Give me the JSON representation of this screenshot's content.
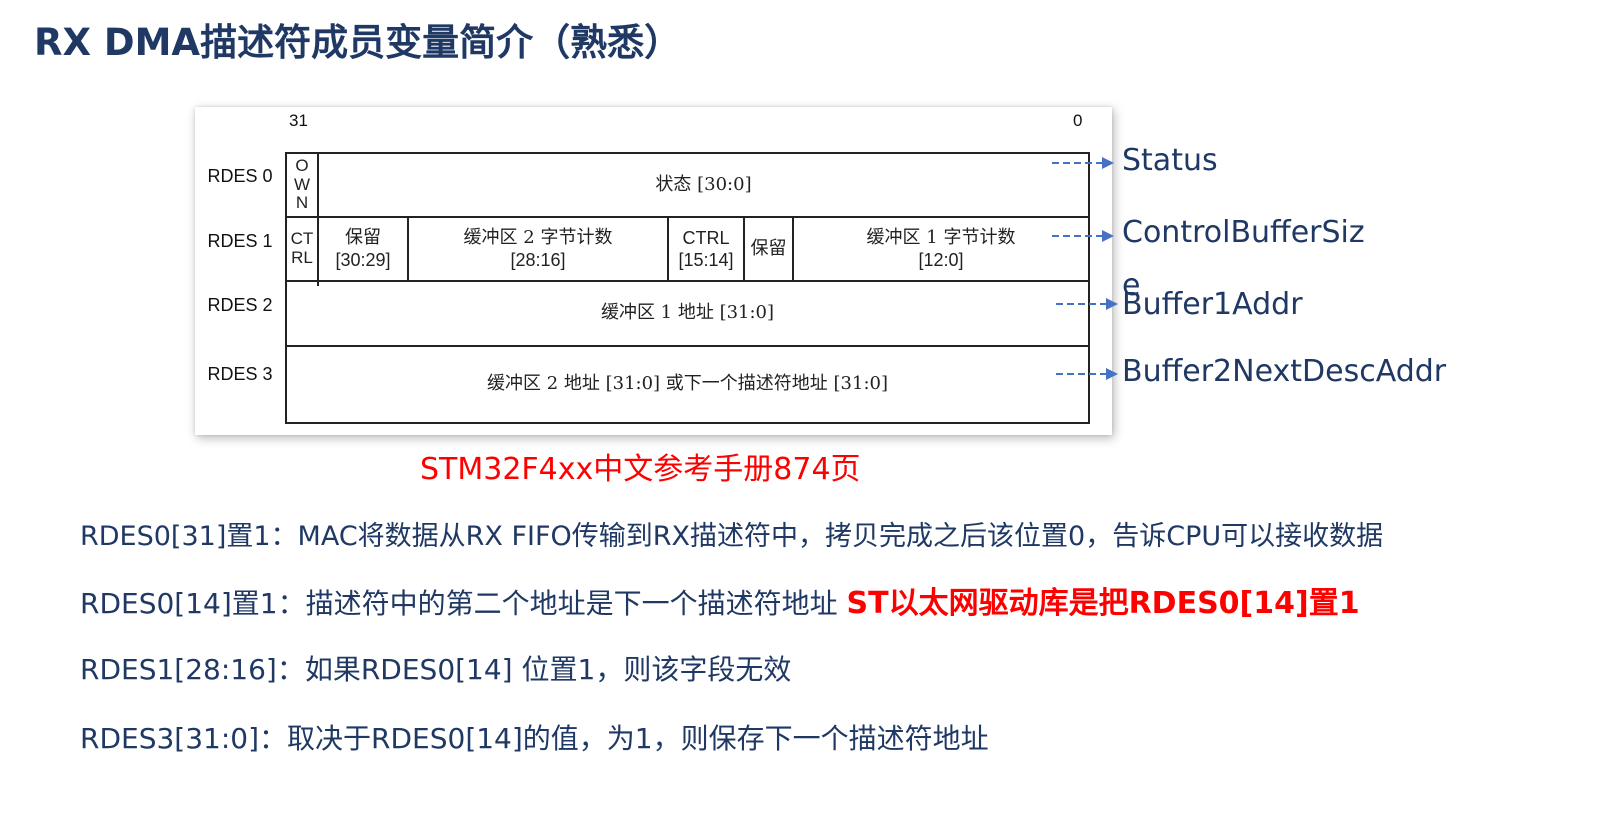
{
  "title": "RX DMA描述符成员变量简介（熟悉）",
  "figure": {
    "bit_high": "31",
    "bit_low": "0",
    "rows": [
      "RDES 0",
      "RDES 1",
      "RDES 2",
      "RDES 3"
    ],
    "own": [
      "O",
      "W",
      "N"
    ],
    "status": "状态 [30:0]",
    "ctrl_left": [
      "CT",
      "RL"
    ],
    "reserved1": [
      "保留",
      "[30:29]"
    ],
    "buf2_count": [
      "缓冲区 2 字节计数",
      "[28:16]"
    ],
    "ctrl_mid": [
      "CTRL",
      "[15:14]"
    ],
    "reserved2": "保留",
    "buf1_count": [
      "缓冲区 1 字节计数",
      "[12:0]"
    ],
    "buf1_addr": "缓冲区 1 地址 [31:0]",
    "buf2_addr": "缓冲区 2 地址 [31:0] 或下一个描述符地址 [31:0]"
  },
  "fields": [
    "Status",
    "ControlBufferSiz",
    "e",
    "Buffer1Addr",
    "Buffer2NextDescAddr"
  ],
  "caption": "STM32F4xx中文参考手册874页",
  "lines": {
    "l1": "RDES0[31]置1：MAC将数据从RX FIFO传输到RX描述符中，拷贝完成之后该位置0，告诉CPU可以接收数据",
    "l2": "RDES0[14]置1：描述符中的第二个地址是下一个描述符地址 ",
    "l2_red": "ST以太网驱动库是把RDES0[14]置1",
    "l3": "RDES1[28:16]：如果RDES0[14] 位置1，则该字段无效",
    "l4": "RDES3[31:0]：取决于RDES0[14]的值，为1，则保存下一个描述符地址"
  },
  "colors": {
    "title": "#1f3864",
    "text": "#1f3864",
    "accent_red": "#ff0000",
    "arrow": "#4472c4"
  }
}
